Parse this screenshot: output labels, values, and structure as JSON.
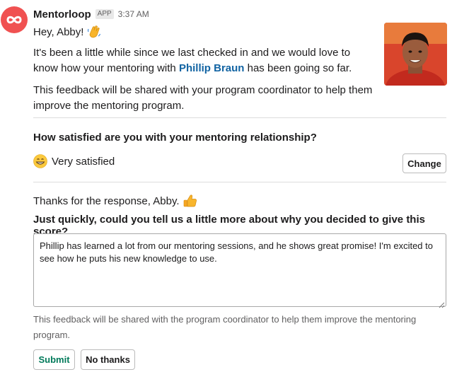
{
  "header": {
    "app_name": "Mentorloop",
    "badge": "APP",
    "time": "3:37 AM",
    "brand_color": "#f04e4e"
  },
  "message": {
    "greeting": "Hey, Abby!",
    "wave_icon": "waving-hand-emoji",
    "para1_before": "It's been a little while since we last checked in and we would love to know how your mentoring with ",
    "mentor_name": "Phillip Braun",
    "para1_after": " has been going so far.",
    "para2": "This feedback will be shared with your program coordinator to help them improve the mentoring program."
  },
  "satisfaction": {
    "question": "How satisfied are you with your mentoring relationship?",
    "answer": "Very satisfied",
    "answer_icon": "grinning-face-emoji",
    "change_label": "Change"
  },
  "followup": {
    "thanks": "Thanks for the response, Abby.",
    "thumb_icon": "thumbs-up-emoji",
    "question": "Just quickly, could you tell us a little more about why you decided to give this score?",
    "response": "Phillip has learned a lot from our mentoring sessions, and he shows great promise! I'm excited to see how he puts his new knowledge to use.",
    "note": "This feedback will be shared with the program coordinator to help them improve the mentoring program."
  },
  "actions": {
    "submit_label": "Submit",
    "no_thanks_label": "No thanks"
  }
}
